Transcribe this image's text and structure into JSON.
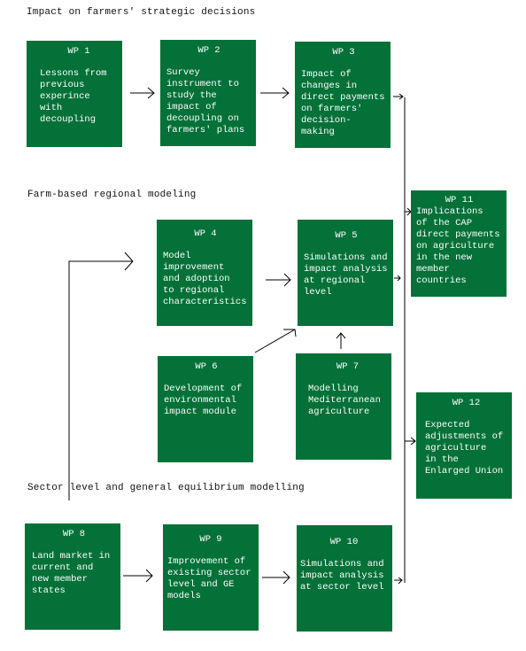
{
  "sections": [
    {
      "title": "Impact on farmers' strategic decisions"
    },
    {
      "title": "Farm-based regional modeling"
    },
    {
      "title": "Sector level and general equilibrium modelling"
    }
  ],
  "box_color": "#037138",
  "work_packages": {
    "wp1": {
      "label": "WP 1",
      "description": "Lessons from\nprevious\nexperince\nwith\ndecoupling"
    },
    "wp2": {
      "label": "WP 2",
      "description": "Survey\ninstrument to\nstudy the\nimpact of\ndecoupling on\nfarmers' plans"
    },
    "wp3": {
      "label": "WP 3",
      "description": "Impact of\nchanges in\ndirect payments\non farmers'\ndecision-\nmaking"
    },
    "wp4": {
      "label": "WP 4",
      "description": "Model\nimprovement\nand adoption\nto regional\ncharacteristics"
    },
    "wp5": {
      "label": "WP 5",
      "description": "Simulations and\nimpact analysis\nat regional\nlevel"
    },
    "wp6": {
      "label": "WP 6",
      "description": "Development of\nenvironmental\nimpact module"
    },
    "wp7": {
      "label": "WP 7",
      "description": "Modelling\nMediterranean\nagriculture"
    },
    "wp8": {
      "label": "WP 8",
      "description": "Land market in\ncurrent and\nnew member\nstates"
    },
    "wp9": {
      "label": "WP 9",
      "description": "Improvement of\nexisting sector\nlevel and GE\nmodels"
    },
    "wp10": {
      "label": "WP 10",
      "description": "Simulations and\nimpact analysis\nat sector level"
    },
    "wp11": {
      "label": "WP 11",
      "description": "Implications\nof the CAP\ndirect payments\non agriculture\nin the new\nmember\ncountries"
    },
    "wp12": {
      "label": "WP 12",
      "description": "Expected\nadjustments of\nagriculture\nin the\nEnlarged Union"
    }
  },
  "connections": [
    {
      "from": "WP 1",
      "to": "WP 2"
    },
    {
      "from": "WP 2",
      "to": "WP 3"
    },
    {
      "from": "WP 3",
      "to": "WP 11"
    },
    {
      "from": "WP 4",
      "to": "WP 5"
    },
    {
      "from": "WP 5",
      "to": "WP 11"
    },
    {
      "from": "WP 6",
      "to": "WP 5"
    },
    {
      "from": "WP 7",
      "to": "WP 5"
    },
    {
      "from": "WP 8",
      "to": "WP 4"
    },
    {
      "from": "WP 8",
      "to": "WP 9"
    },
    {
      "from": "WP 9",
      "to": "WP 10"
    },
    {
      "from": "WP 10",
      "to": "WP 11"
    },
    {
      "from": "WP 10",
      "to": "WP 12"
    }
  ]
}
